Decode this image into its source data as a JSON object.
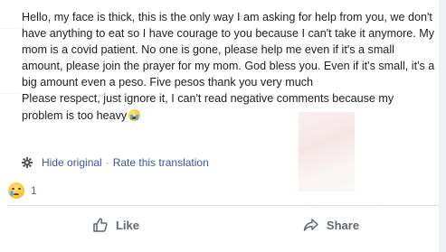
{
  "post": {
    "text": "Hello, my face is thick, this is the only way I am asking for help from you, we don't have anything to eat so I have courage to you because I can't take it anymore. My mom is a covid patient. No one is gone, please help me even if it's a small amount, please join the prayer for my mom. God bless you. Even if it's small, it's a big amount even a peso. Five pesos thank you very much\nPlease respect, just ignore it, I can't read negative comments because my problem is too heavy",
    "trailing_emoji": "crying-face-emoji"
  },
  "translation": {
    "icon": "gear-icon",
    "hide_label": "Hide original",
    "separator": "·",
    "rate_label": "Rate this translation"
  },
  "reactions": {
    "icon": "sad-reaction-icon",
    "count": "1"
  },
  "actions": {
    "like_label": "Like",
    "share_label": "Share"
  },
  "colors": {
    "text": "#1c1e21",
    "link": "#385898",
    "muted": "#606770",
    "divider": "#dadde1"
  }
}
